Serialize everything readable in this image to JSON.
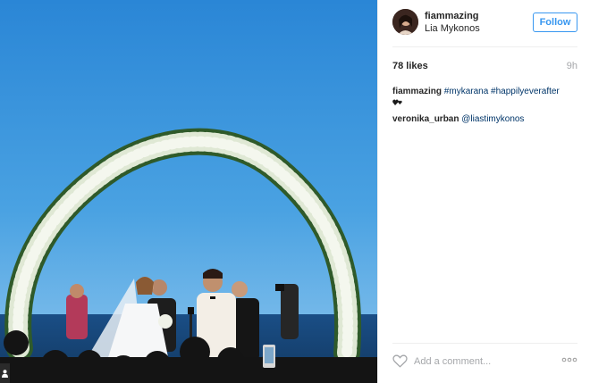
{
  "header": {
    "username": "fiammazing",
    "location": "Lia Mykonos",
    "follow_label": "Follow",
    "avatar_icon": "profile-photo"
  },
  "meta": {
    "likes": "78 likes",
    "time_ago": "9h"
  },
  "caption": {
    "author": "fiammazing",
    "hashtags": [
      "#mykarana",
      "#happilyeverafter"
    ],
    "emoji_icon": "two-hearts-icon"
  },
  "comments": [
    {
      "author": "veronika_urban",
      "text": "@liastimykonos"
    }
  ],
  "footer": {
    "comment_placeholder": "Add a comment...",
    "like_icon": "heart-icon",
    "more_icon": "more-options-icon"
  },
  "photo": {
    "subject": "wedding ceremony under floral arch",
    "tag_icon": "person-tag-icon"
  },
  "colors": {
    "accent": "#3897f0",
    "link": "#003569",
    "muted": "#a5a7aa",
    "divider": "#efefef"
  }
}
